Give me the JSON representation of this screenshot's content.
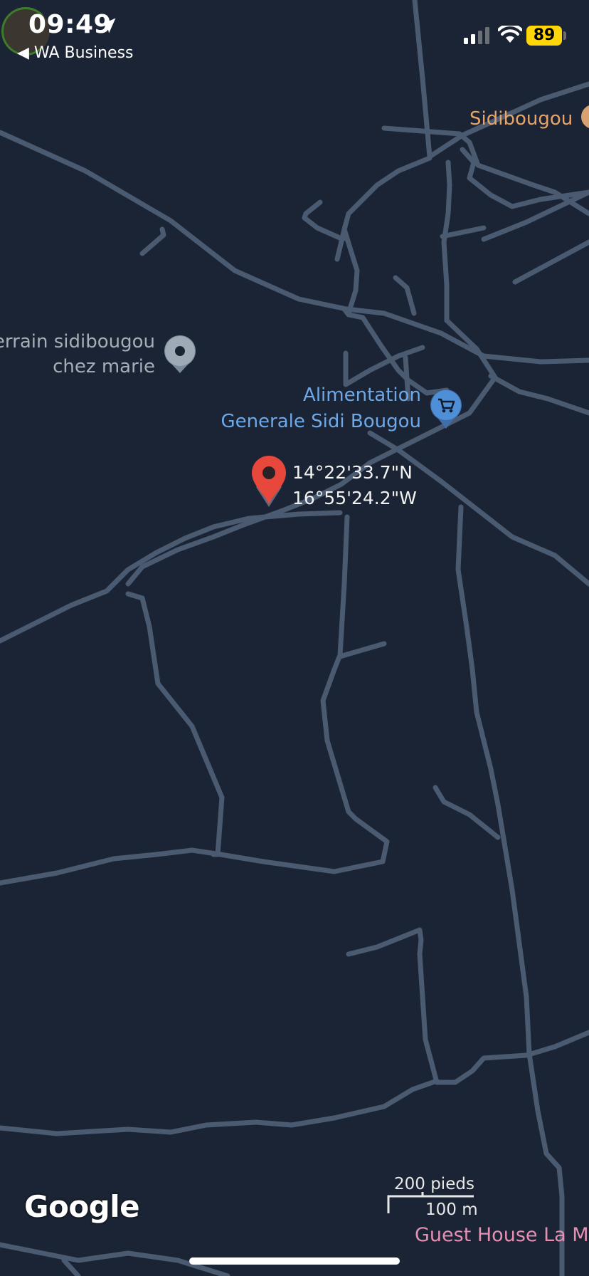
{
  "status_bar": {
    "time": "09:49",
    "back_app": "◀ WA Business",
    "battery": "89"
  },
  "map": {
    "places": {
      "sidibougou": "Sidibougou",
      "terrain_line1": "errain sidibougou",
      "terrain_line2": "chez marie",
      "alimentation_line1": "Alimentation",
      "alimentation_line2": "Generale Sidi Bougou",
      "guest_house": "Guest House La Ma"
    },
    "pin": {
      "latitude": "14°22'33.7\"N",
      "longitude": "16°55'24.2\"W"
    },
    "attribution": "Google",
    "scale": {
      "imperial": "200 pieds",
      "metric": "100 m"
    }
  },
  "colors": {
    "map_background": "#1b2434",
    "road": "#4a5a70",
    "pin": "#e8473c",
    "battery": "#ffd60a",
    "poi_orange": "#e6a468",
    "poi_blue": "#6fa8e6",
    "poi_pink": "#e58fb3"
  },
  "icons": {
    "location_arrow": "location-arrow-icon",
    "signal": "cellular-signal-icon",
    "wifi": "wifi-icon",
    "shopping_cart": "shopping-cart-icon",
    "map_pin": "map-pin-icon"
  }
}
